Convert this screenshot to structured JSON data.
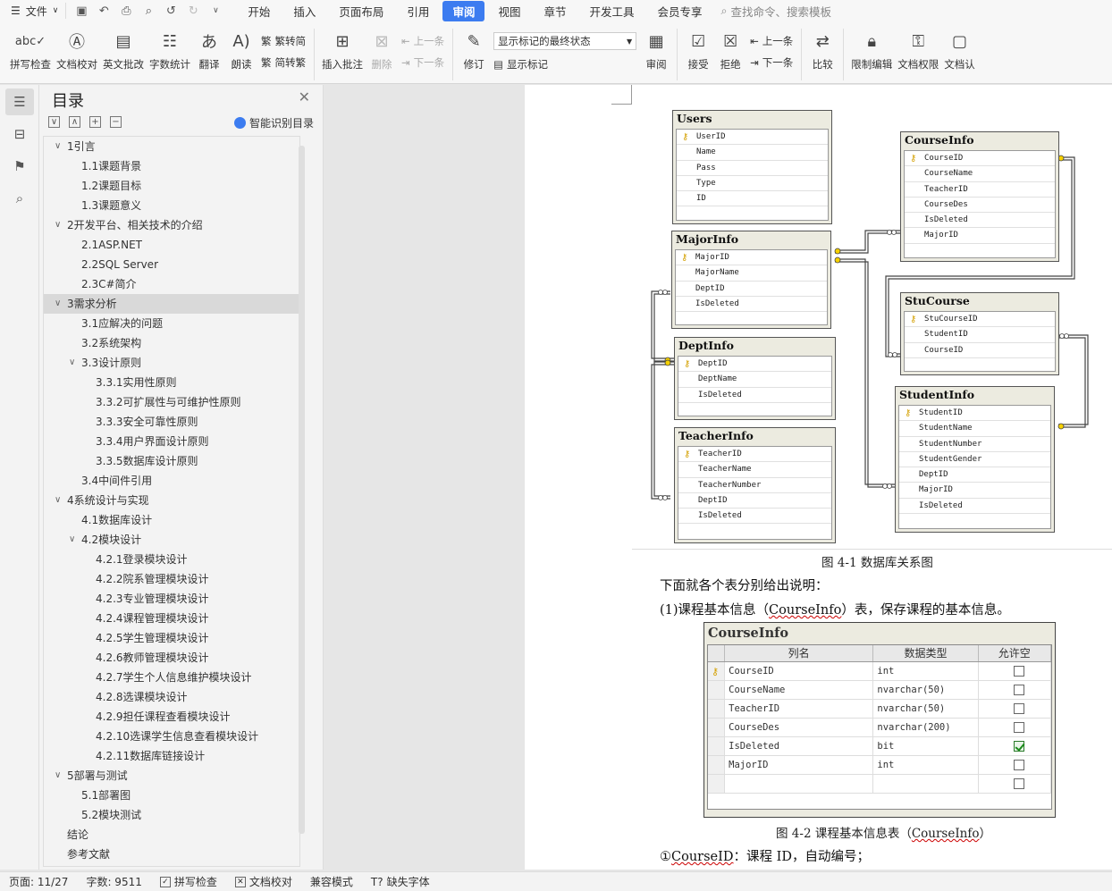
{
  "menubar": {
    "file_label": "文件",
    "tabs": [
      "开始",
      "插入",
      "页面布局",
      "引用",
      "审阅",
      "视图",
      "章节",
      "开发工具",
      "会员专享"
    ],
    "active_tab": "审阅",
    "search_placeholder": "查找命令、搜索模板"
  },
  "ribbon": {
    "spell_check": "拼写检查",
    "doc_proofread": "文档校对",
    "english_review": "英文批改",
    "word_count": "字数统计",
    "translate": "翻译",
    "read_aloud": "朗读",
    "trad_to_simp": "繁转简",
    "simp_to_trad": "简转繁",
    "insert_comment": "插入批注",
    "delete": "删除",
    "prev": "上一条",
    "next": "下一条",
    "revise": "修订",
    "markup_state": "显示标记的最终状态",
    "show_markup": "显示标记",
    "review": "审阅",
    "accept": "接受",
    "reject": "拒绝",
    "prev2": "上一条",
    "next2": "下一条",
    "compare": "比较",
    "restrict_edit": "限制编辑",
    "doc_permission": "文档权限",
    "doc_cut": "文档认"
  },
  "toc": {
    "title": "目录",
    "smart_label": "智能识别目录",
    "items": [
      {
        "text": "1引言",
        "level": 1,
        "chev": true
      },
      {
        "text": "1.1课题背景",
        "level": 2
      },
      {
        "text": "1.2课题目标",
        "level": 2
      },
      {
        "text": "1.3课题意义",
        "level": 2
      },
      {
        "text": "2开发平台、相关技术的介绍",
        "level": 1,
        "chev": true
      },
      {
        "text": "2.1ASP.NET",
        "level": 2
      },
      {
        "text": "2.2SQL Server",
        "level": 2
      },
      {
        "text": "2.3C#简介",
        "level": 2
      },
      {
        "text": "3需求分析",
        "level": 1,
        "chev": true,
        "selected": true
      },
      {
        "text": "3.1应解决的问题",
        "level": 2
      },
      {
        "text": "3.2系统架构",
        "level": 2
      },
      {
        "text": "3.3设计原则",
        "level": 2,
        "chev": true
      },
      {
        "text": "3.3.1实用性原则",
        "level": 3
      },
      {
        "text": "3.3.2可扩展性与可维护性原则",
        "level": 3
      },
      {
        "text": "3.3.3安全可靠性原则",
        "level": 3
      },
      {
        "text": "3.3.4用户界面设计原则",
        "level": 3
      },
      {
        "text": "3.3.5数据库设计原则",
        "level": 3
      },
      {
        "text": "3.4中间件引用",
        "level": 2
      },
      {
        "text": "4系统设计与实现",
        "level": 1,
        "chev": true
      },
      {
        "text": "4.1数据库设计",
        "level": 2
      },
      {
        "text": "4.2模块设计",
        "level": 2,
        "chev": true
      },
      {
        "text": "4.2.1登录模块设计",
        "level": 3
      },
      {
        "text": "4.2.2院系管理模块设计",
        "level": 3
      },
      {
        "text": "4.2.3专业管理模块设计",
        "level": 3
      },
      {
        "text": "4.2.4课程管理模块设计",
        "level": 3
      },
      {
        "text": "4.2.5学生管理模块设计",
        "level": 3
      },
      {
        "text": "4.2.6教师管理模块设计",
        "level": 3
      },
      {
        "text": "4.2.7学生个人信息维护模块设计",
        "level": 3
      },
      {
        "text": "4.2.8选课模块设计",
        "level": 3
      },
      {
        "text": "4.2.9担任课程查看模块设计",
        "level": 3
      },
      {
        "text": "4.2.10选课学生信息查看模块设计",
        "level": 3
      },
      {
        "text": "4.2.11数据库链接设计",
        "level": 3
      },
      {
        "text": "5部署与测试",
        "level": 1,
        "chev": true
      },
      {
        "text": "5.1部署图",
        "level": 2
      },
      {
        "text": "5.2模块测试",
        "level": 2
      },
      {
        "text": "结论",
        "level": 1
      },
      {
        "text": "参考文献",
        "level": 1
      }
    ]
  },
  "diagram": {
    "tables": [
      {
        "name": "Users",
        "cols": [
          "UserID",
          "Name",
          "Pass",
          "Type",
          "ID"
        ],
        "pk": [
          0
        ]
      },
      {
        "name": "CourseInfo",
        "cols": [
          "CourseID",
          "CourseName",
          "TeacherID",
          "CourseDes",
          "IsDeleted",
          "MajorID"
        ],
        "pk": [
          0
        ]
      },
      {
        "name": "MajorInfo",
        "cols": [
          "MajorID",
          "MajorName",
          "DeptID",
          "IsDeleted"
        ],
        "pk": [
          0
        ]
      },
      {
        "name": "StuCourse",
        "cols": [
          "StuCourseID",
          "StudentID",
          "CourseID"
        ],
        "pk": [
          0
        ]
      },
      {
        "name": "DeptInfo",
        "cols": [
          "DeptID",
          "DeptName",
          "IsDeleted"
        ],
        "pk": [
          0
        ]
      },
      {
        "name": "StudentInfo",
        "cols": [
          "StudentID",
          "StudentName",
          "StudentNumber",
          "StudentGender",
          "DeptID",
          "MajorID",
          "IsDeleted"
        ],
        "pk": [
          0
        ]
      },
      {
        "name": "TeacherInfo",
        "cols": [
          "TeacherID",
          "TeacherName",
          "TeacherNumber",
          "DeptID",
          "IsDeleted"
        ],
        "pk": [
          0
        ]
      }
    ],
    "caption": "图 4-1  数据库关系图"
  },
  "body": {
    "para1": "下面就各个表分别给出说明：",
    "para2_pre": "(1)课程基本信息（",
    "para2_link": "CourseInfo",
    "para2_post": "）表，保存课程的基本信息。",
    "table_title": "CourseInfo",
    "table_headers": [
      "列名",
      "数据类型",
      "允许空"
    ],
    "table_rows": [
      {
        "name": "CourseID",
        "type": "int",
        "null": false,
        "pk": true
      },
      {
        "name": "CourseName",
        "type": "nvarchar(50)",
        "null": false
      },
      {
        "name": "TeacherID",
        "type": "nvarchar(50)",
        "null": false
      },
      {
        "name": "CourseDes",
        "type": "nvarchar(200)",
        "null": false
      },
      {
        "name": "IsDeleted",
        "type": "bit",
        "null": true
      },
      {
        "name": "MajorID",
        "type": "int",
        "null": false
      },
      {
        "name": "",
        "type": "",
        "null": false
      }
    ],
    "caption2_pre": "图 4-2  课程基本信息表（",
    "caption2_link": "CourseInfo",
    "caption2_post": "）",
    "para3_mark": "①",
    "para3_link": "CourseID",
    "para3_post": "：课程 ID，自动编号；"
  },
  "status": {
    "page": "页面: 11/27",
    "words": "字数: 9511",
    "spell": "拼写检查",
    "proof": "文档校对",
    "compat": "兼容模式",
    "missing_font": "缺失字体"
  },
  "colors": {
    "accent": "#3c7cf0"
  }
}
